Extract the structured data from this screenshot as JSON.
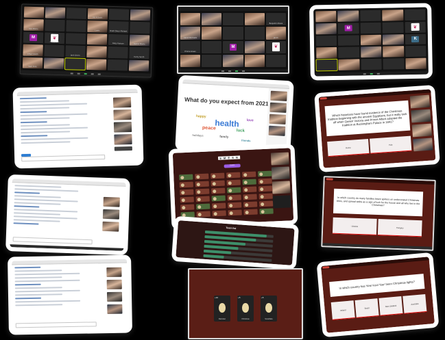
{
  "collage": {
    "zoom_grid_1": {
      "names": [
        "",
        "",
        "",
        "Ms R Davis",
        "",
        "",
        "Kira Moore",
        "",
        "",
        "Lewis",
        "Noah Owen Michaels",
        "",
        "",
        "Mary Jones",
        "",
        "",
        "Ruby Hanson",
        "Daniel Moore",
        "Ethan Smith",
        "",
        "Jack Green",
        "",
        "",
        "Harry Smith",
        "Sam Ford",
        "",
        "",
        "",
        "",
        ""
      ],
      "letter": "M"
    },
    "zoom_grid_2": {
      "names": [
        "",
        "",
        "",
        "",
        "Benjamin Davis",
        "Sarah Michaels",
        "",
        "",
        "",
        "Jacob",
        "Emma Green",
        "",
        "",
        "",
        "",
        "",
        "",
        "",
        "",
        "",
        ""
      ],
      "letter": "M"
    },
    "zoom_grid_3": {
      "letters": [
        "M",
        "K"
      ]
    },
    "word_cloud": {
      "title": "What do you expect from 2021?",
      "words": [
        "health",
        "peace",
        "luck",
        "happy",
        "love",
        "family",
        "holidays",
        "friends"
      ]
    },
    "quiz_1": {
      "question": "Which historians have found evidence of the Christmas tradition beginning with the ancient Egyptians, but it really took off when Queen Victoria and Prince Albert adopted the tradition at Buckingham Palace in 1841?",
      "options": [
        "Rome",
        "Yule"
      ]
    },
    "quiz_2": {
      "question": "In which country do many families leave spiders on undecorated Christmas trees, and spread webs as a sign of luck for the house and all who live in the Christmas?",
      "options": [
        "Ukraine",
        "Hungary"
      ]
    },
    "quiz_3": {
      "question": "In which country has 'Kiwi Kool Yaw' been Christmas lights?",
      "options": [
        "Ireland",
        "Brazil",
        "New Zealand",
        "Australia"
      ]
    },
    "board": {
      "letters": "S M E S N",
      "button": "Guess"
    },
    "cards_game": {
      "cards": [
        {
          "top": "+10",
          "label": "Reindeer"
        },
        {
          "top": "+5",
          "label": "Christmas"
        },
        {
          "top": "+5",
          "label": "Snowflake"
        }
      ]
    },
    "scoreboard": {
      "title": "Team list",
      "fills": [
        0.9,
        0.75,
        0.6,
        0.5,
        0.4,
        0.3
      ]
    }
  },
  "colors": {
    "background": "#000000",
    "frame": "#ffffff",
    "quiz_dark_red": "#5a1c14",
    "zoom_purple": "#a01ea8",
    "accent_green": "#3cb05a"
  }
}
